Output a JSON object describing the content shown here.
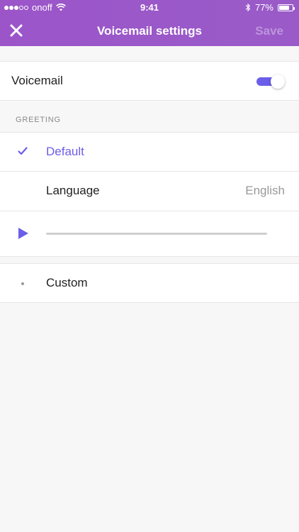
{
  "status_bar": {
    "carrier": "onoff",
    "time": "9:41",
    "battery_percent": "77%",
    "battery_level": 0.77,
    "signal_filled": 3,
    "signal_total": 5
  },
  "nav": {
    "title": "Voicemail settings",
    "close_icon": "close-x-icon",
    "save_label": "Save"
  },
  "voicemail": {
    "label": "Voicemail",
    "enabled": true
  },
  "greeting": {
    "section_title": "GREETING",
    "default_label": "Default",
    "default_selected": true,
    "language_label": "Language",
    "language_value": "English",
    "playback_progress": 0.0,
    "custom_label": "Custom"
  },
  "colors": {
    "header": "#9b55c9",
    "accent": "#6b5ee8"
  }
}
